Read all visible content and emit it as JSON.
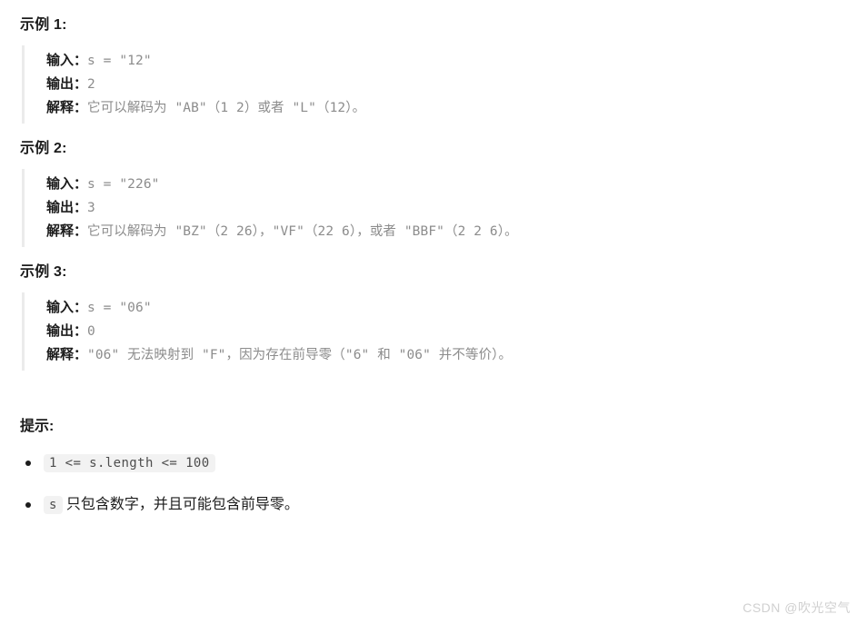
{
  "examples": [
    {
      "heading": "示例 1:",
      "lines": [
        {
          "label": "输入：",
          "value": "s = \"12\""
        },
        {
          "label": "输出：",
          "value": "2"
        },
        {
          "label": "解释：",
          "value": "它可以解码为 \"AB\"（1 2）或者 \"L\"（12）。"
        }
      ]
    },
    {
      "heading": "示例 2:",
      "lines": [
        {
          "label": "输入：",
          "value": "s = \"226\""
        },
        {
          "label": "输出：",
          "value": "3"
        },
        {
          "label": "解释：",
          "value": "它可以解码为 \"BZ\"（2 26），\"VF\"（22 6），或者 \"BBF\"（2 2 6）。"
        }
      ]
    },
    {
      "heading": "示例 3:",
      "lines": [
        {
          "label": "输入：",
          "value": "s = \"06\""
        },
        {
          "label": "输出：",
          "value": "0"
        },
        {
          "label": "解释：",
          "value": "\"06\" 无法映射到 \"F\"，因为存在前导零（\"6\" 和 \"06\" 并不等价）。"
        }
      ]
    }
  ],
  "hints": {
    "heading": "提示:",
    "items": [
      {
        "code": "1 <= s.length <= 100",
        "text": ""
      },
      {
        "code": "s",
        "text": "只包含数字，并且可能包含前导零。"
      }
    ]
  },
  "watermark": "CSDN @吹光空气",
  "colors": {
    "text": "#1c1c1c",
    "muted": "#8c8c8c",
    "quote_border": "#ebebeb",
    "code_bg": "#f2f2f2",
    "watermark": "#d0d0d0"
  }
}
